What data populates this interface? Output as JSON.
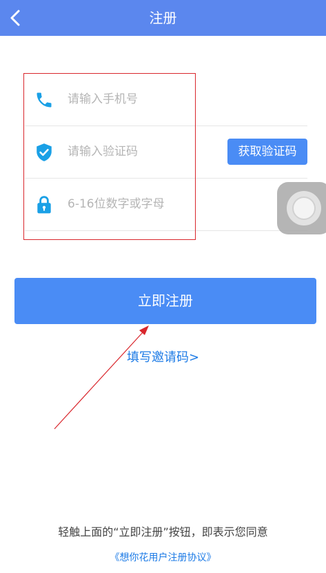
{
  "header": {
    "title": "注册",
    "back_icon": "chevron-left-icon"
  },
  "form": {
    "phone": {
      "placeholder": "请输入手机号",
      "value": "",
      "icon": "phone-icon"
    },
    "code": {
      "placeholder": "请输入验证码",
      "value": "",
      "icon": "shield-check-icon",
      "button_label": "获取验证码"
    },
    "password": {
      "placeholder": "6-16位数字或字母",
      "value": "",
      "icon": "lock-icon"
    }
  },
  "actions": {
    "register_label": "立即注册",
    "invite_label": "填写邀请码>"
  },
  "footer": {
    "agree_text": "轻触上面的“立即注册”按钮，即表示您同意",
    "agreement_link": "《想你花用户注册协议》"
  },
  "colors": {
    "navbar": "#5b87ee",
    "primary_button": "#4a8cf5",
    "link": "#1d7be6",
    "icon": "#1aa0e6",
    "annotation": "#d9262c"
  }
}
